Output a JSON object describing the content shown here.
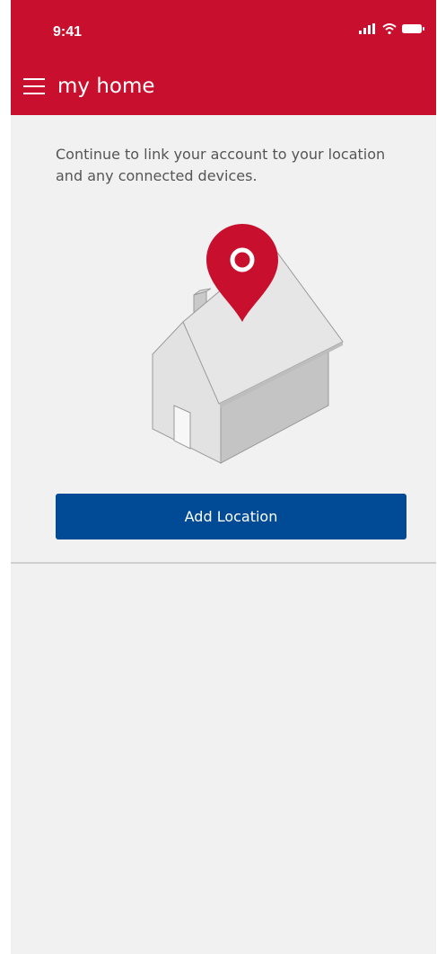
{
  "status_bar": {
    "time": "9:41",
    "icons": [
      "signal-icon",
      "wifi-icon",
      "battery-icon"
    ]
  },
  "header": {
    "menu_icon": "hamburger-menu-icon",
    "title": "my home",
    "background_color": "#c8102e"
  },
  "main": {
    "intro_text": "Continue to link your account to your location and any connected devices.",
    "illustration": "house-with-location-pin",
    "pin_color": "#c8102e",
    "add_location_label": "Add Location",
    "button_color": "#004a96"
  }
}
